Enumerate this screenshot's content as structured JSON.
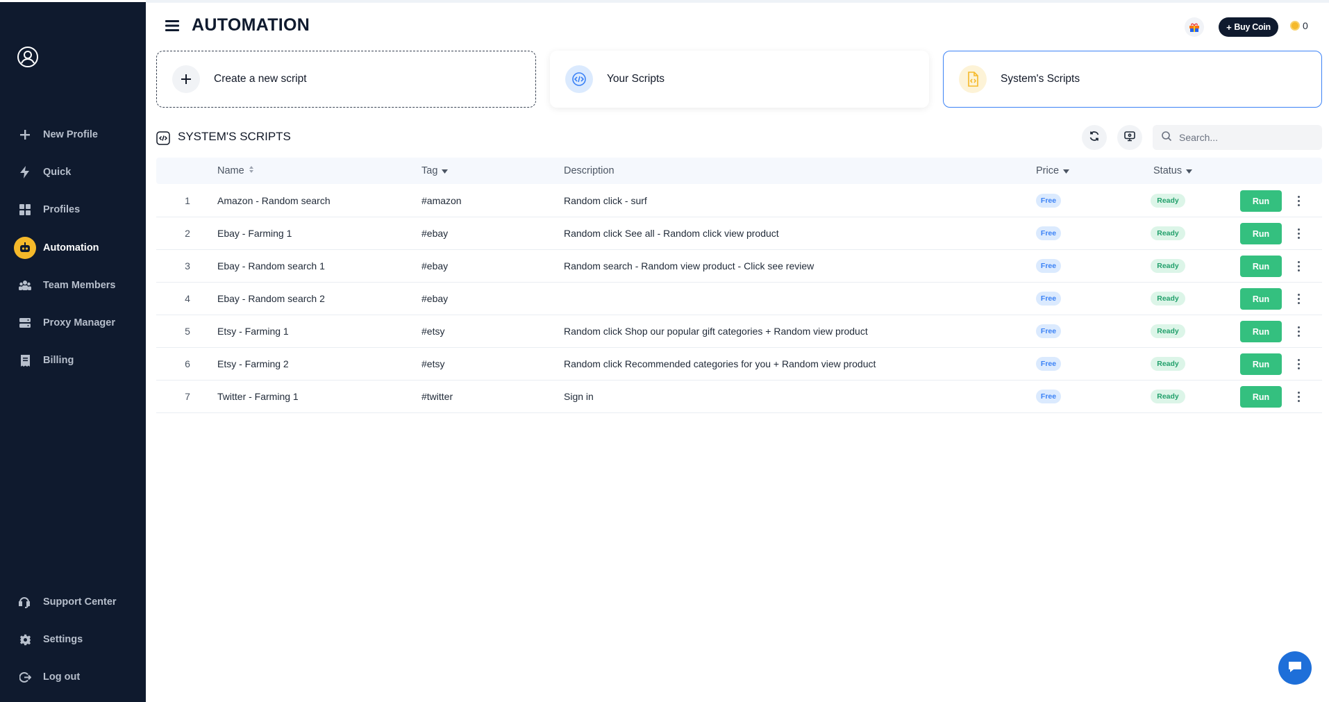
{
  "header": {
    "title": "AUTOMATION",
    "buy_coin_label": "Buy Coin",
    "coin_count": "0"
  },
  "sidebar": {
    "items": [
      {
        "label": "New Profile",
        "icon": "plus-icon"
      },
      {
        "label": "Quick",
        "icon": "bolt-icon"
      },
      {
        "label": "Profiles",
        "icon": "grid-icon"
      },
      {
        "label": "Automation",
        "icon": "robot-icon",
        "active": true
      },
      {
        "label": "Team Members",
        "icon": "team-icon"
      },
      {
        "label": "Proxy Manager",
        "icon": "server-icon"
      },
      {
        "label": "Billing",
        "icon": "billing-icon"
      }
    ],
    "bottom_items": [
      {
        "label": "Support Center",
        "icon": "support-icon"
      },
      {
        "label": "Settings",
        "icon": "gear-icon"
      },
      {
        "label": "Log out",
        "icon": "logout-icon"
      }
    ]
  },
  "cards": {
    "create": "Create a new script",
    "your": "Your Scripts",
    "system": "System's Scripts"
  },
  "section": {
    "title": "SYSTEM'S SCRIPTS",
    "search_placeholder": "Search..."
  },
  "table": {
    "columns": {
      "name": "Name",
      "tag": "Tag",
      "description": "Description",
      "price": "Price",
      "status": "Status"
    },
    "run_label": "Run",
    "rows": [
      {
        "index": "1",
        "name": "Amazon - Random search",
        "tag": "#amazon",
        "description": "Random click - surf",
        "price": "Free",
        "status": "Ready"
      },
      {
        "index": "2",
        "name": "Ebay - Farming 1",
        "tag": "#ebay",
        "description": "Random click See all - Random click view product",
        "price": "Free",
        "status": "Ready"
      },
      {
        "index": "3",
        "name": "Ebay - Random search 1",
        "tag": "#ebay",
        "description": "Random search - Random view product - Click see review",
        "price": "Free",
        "status": "Ready"
      },
      {
        "index": "4",
        "name": "Ebay - Random search 2",
        "tag": "#ebay",
        "description": "",
        "price": "Free",
        "status": "Ready"
      },
      {
        "index": "5",
        "name": "Etsy - Farming 1",
        "tag": "#etsy",
        "description": "Random click Shop our popular gift categories + Random view product",
        "price": "Free",
        "status": "Ready"
      },
      {
        "index": "6",
        "name": "Etsy - Farming 2",
        "tag": "#etsy",
        "description": "Random click Recommended categories for you + Random view product",
        "price": "Free",
        "status": "Ready"
      },
      {
        "index": "7",
        "name": "Twitter - Farming 1",
        "tag": "#twitter",
        "description": "Sign in",
        "price": "Free",
        "status": "Ready"
      }
    ]
  },
  "colors": {
    "sidebar_bg": "#0f1a2e",
    "accent_yellow": "#f5b92a",
    "run_green": "#34c07f",
    "ready_green": "#22a06b",
    "free_blue": "#3b82f6",
    "chat_blue": "#1e6fd9"
  }
}
